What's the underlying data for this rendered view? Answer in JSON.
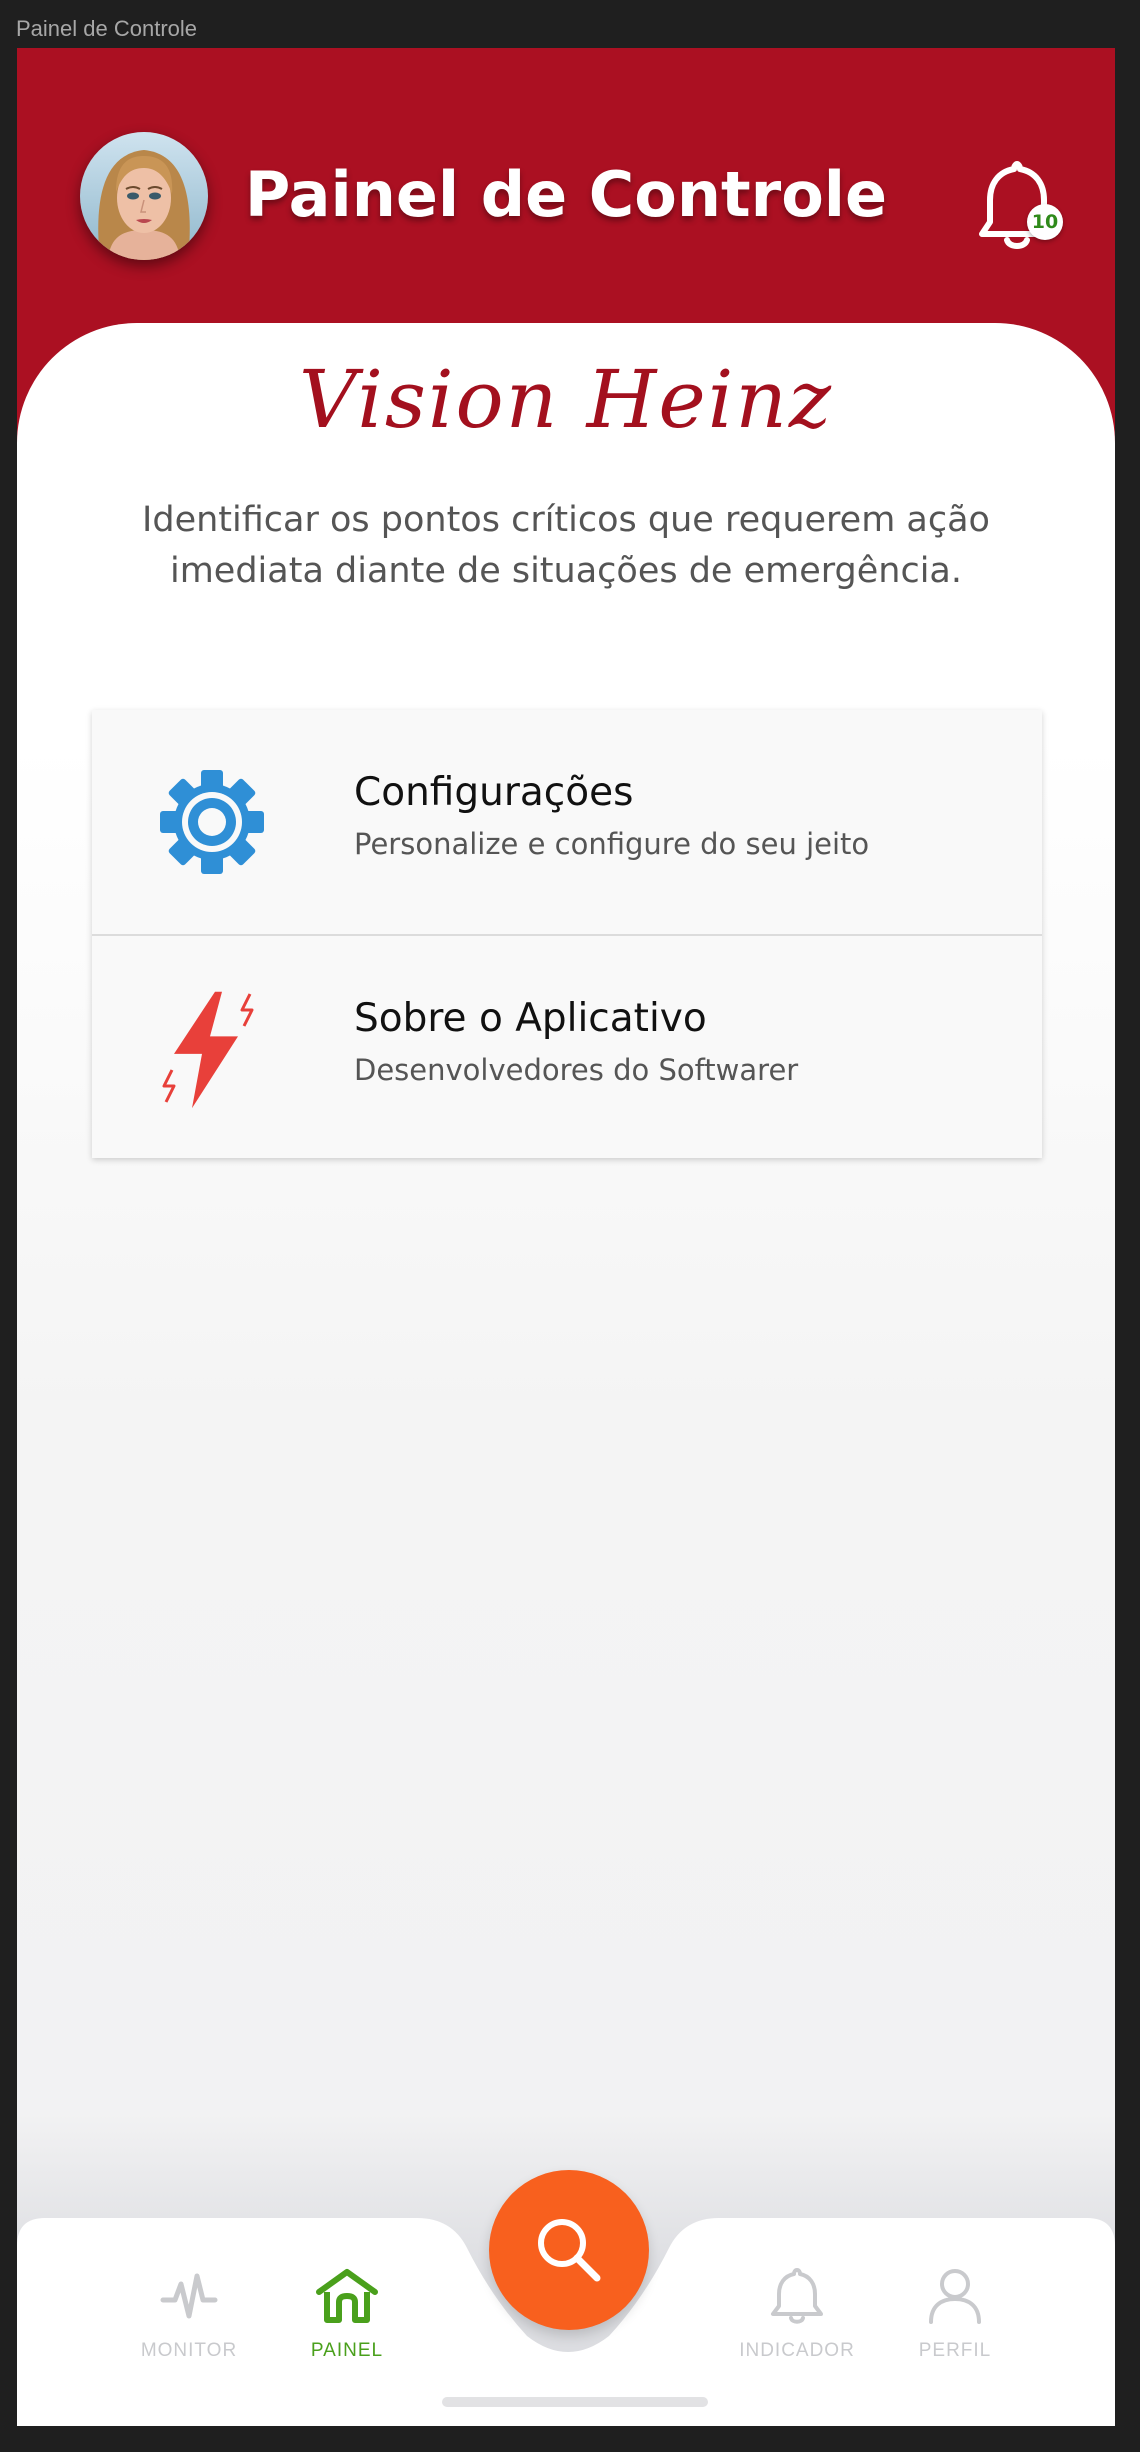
{
  "window": {
    "title": "Painel de Controle"
  },
  "header": {
    "title": "Painel de Controle",
    "notification_count": "10"
  },
  "brand": {
    "name": "Vision Heinz"
  },
  "tagline": "Identificar os pontos críticos que requerem ação imediata diante de situações de emergência.",
  "menu": [
    {
      "title": "Configurações",
      "subtitle": "Personalize e configure do seu jeito",
      "icon": "gear-icon"
    },
    {
      "title": "Sobre o Aplicativo",
      "subtitle": "Desenvolvedores do Softwarer",
      "icon": "lightning-icon"
    }
  ],
  "nav": {
    "items": [
      {
        "label": "MONITOR",
        "icon": "pulse-icon",
        "active": false
      },
      {
        "label": "PAINEL",
        "icon": "home-icon",
        "active": true
      },
      {
        "label": "INDICADOR",
        "icon": "bell-icon",
        "active": false
      },
      {
        "label": "PERFIL",
        "icon": "user-icon",
        "active": false
      }
    ],
    "fab_icon": "search-icon"
  },
  "colors": {
    "header_bg": "#ab1022",
    "brand_text": "#a3101e",
    "fab": "#f8601e",
    "active_nav": "#4aa01c",
    "inactive_nav": "#c9cacd",
    "gear": "#2f8fd6",
    "lightning": "#e8403a"
  }
}
